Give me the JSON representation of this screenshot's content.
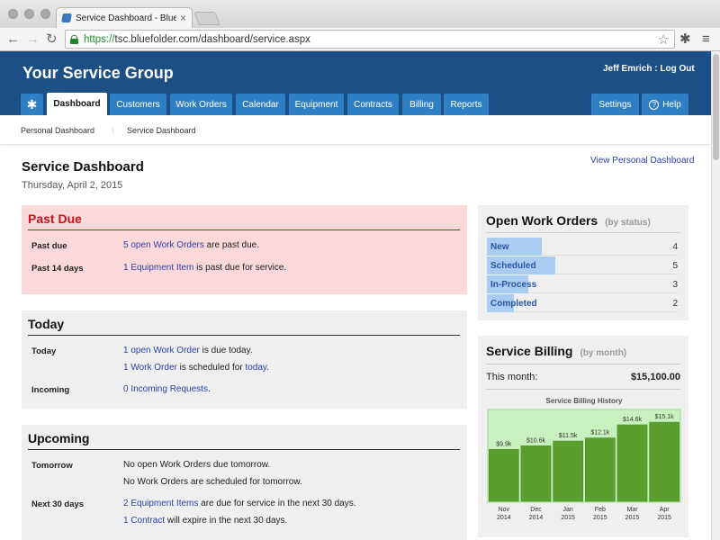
{
  "browser": {
    "tab_title": "Service Dashboard - BlueF",
    "url_scheme": "https://",
    "url_rest": "tsc.bluefolder.com/dashboard/service.aspx"
  },
  "header": {
    "brand": "Your Service Group",
    "user_name": "Jeff Emrich",
    "separator": " : ",
    "logout": "Log Out"
  },
  "nav": {
    "tabs": [
      "Dashboard",
      "Customers",
      "Work Orders",
      "Calendar",
      "Equipment",
      "Contracts",
      "Billing",
      "Reports"
    ],
    "settings": "Settings",
    "help": "Help"
  },
  "subnav": {
    "personal": "Personal Dashboard",
    "service": "Service Dashboard"
  },
  "page": {
    "title": "Service Dashboard",
    "date": "Thursday, April 2, 2015",
    "view_personal": "View Personal Dashboard"
  },
  "past_due": {
    "title": "Past Due",
    "rows": [
      {
        "label": "Past due",
        "link": "5 open Work Orders",
        "text": " are past due."
      },
      {
        "label": "Past 14 days",
        "link": "1 Equipment Item",
        "text": " is past due for service."
      }
    ]
  },
  "today": {
    "title": "Today",
    "label_today": "Today",
    "label_incoming": "Incoming",
    "line1_link": "1 open Work Order",
    "line1_text": " is due today.",
    "line2_link": "1 Work Order",
    "line2_text": " is scheduled for ",
    "line2_link2": "today",
    "line2_end": ".",
    "incoming_link": "0 Incoming Requests",
    "incoming_end": "."
  },
  "upcoming": {
    "title": "Upcoming",
    "label_tomorrow": "Tomorrow",
    "label_next30": "Next 30 days",
    "tomorrow_line1": "No open Work Orders due tomorrow.",
    "tomorrow_line2": "No Work Orders are scheduled for tomorrow.",
    "next_line1_link": "2 Equipment Items",
    "next_line1_text": " are due for service in the next 30 days.",
    "next_line2_link": "1 Contract",
    "next_line2_text": " will expire in the next 30 days."
  },
  "open_work_orders": {
    "title": "Open Work Orders",
    "subtitle": "(by status)",
    "rows": [
      {
        "name": "New",
        "count": 4
      },
      {
        "name": "Scheduled",
        "count": 5
      },
      {
        "name": "In-Process",
        "count": 3
      },
      {
        "name": "Completed",
        "count": 2
      }
    ]
  },
  "service_billing": {
    "title": "Service Billing",
    "subtitle": "(by month)",
    "this_month_label": "This month:",
    "this_month_value": "$15,100.00"
  },
  "colors": {
    "header_blue": "#1c4f86",
    "tab_blue": "#2f7fc4",
    "past_due_red": "#c2151b",
    "bar_green": "#5a9e2e",
    "chart_bg": "#c9f0bf"
  },
  "chart_data": {
    "type": "bar",
    "title": "Service Billing History",
    "categories": [
      "Nov 2014",
      "Dec 2014",
      "Jan 2015",
      "Feb 2015",
      "Mar 2015",
      "Apr 2015"
    ],
    "category_lines": [
      [
        "Nov",
        "2014"
      ],
      [
        "Dec",
        "2014"
      ],
      [
        "Jan",
        "2015"
      ],
      [
        "Feb",
        "2015"
      ],
      [
        "Mar",
        "2015"
      ],
      [
        "Apr",
        "2015"
      ]
    ],
    "values": [
      9900,
      10600,
      11500,
      12100,
      14600,
      15100
    ],
    "data_labels": [
      "$9.9k",
      "$10.6k",
      "$11.5k",
      "$12.1k",
      "$14.6k",
      "$15.1k"
    ],
    "ylim": [
      0,
      17000
    ],
    "grid": false,
    "xlabel": "",
    "ylabel": ""
  }
}
